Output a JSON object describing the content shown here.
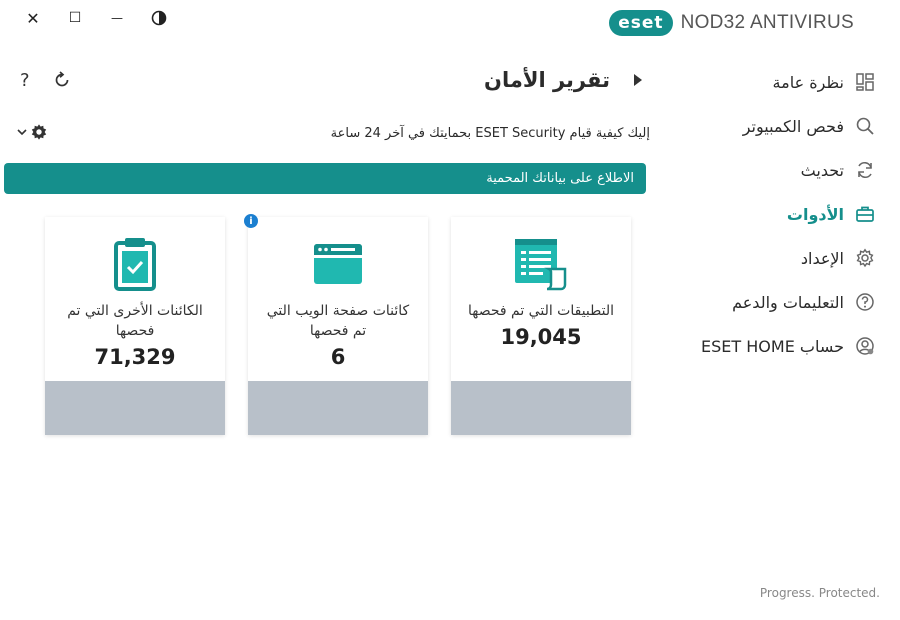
{
  "window": {
    "close_glyph": "✕",
    "maximize_glyph": "☐",
    "minimize_glyph": "—",
    "theme_icon": "contrast-icon"
  },
  "brand": {
    "logo_text": "eset",
    "product": "NOD32 ANTIVIRUS",
    "color": "#158f8c"
  },
  "sidebar": {
    "items": [
      {
        "label": "نظرة عامة",
        "icon": "dashboard-icon",
        "active": false
      },
      {
        "label": "فحص الكمبيوتر",
        "icon": "search-icon",
        "active": false
      },
      {
        "label": "تحديث",
        "icon": "refresh-icon",
        "active": false
      },
      {
        "label": "الأدوات",
        "icon": "toolbox-icon",
        "active": true
      },
      {
        "label": "الإعداد",
        "icon": "gear-icon",
        "active": false
      },
      {
        "label": "التعليمات والدعم",
        "icon": "help-icon",
        "active": false
      },
      {
        "label": "حساب ESET HOME",
        "icon": "user-icon",
        "active": false
      }
    ]
  },
  "header": {
    "title": "تقرير الأمان",
    "help_glyph": "?"
  },
  "subheader": {
    "text": "إليك كيفية قيام ESET Security بحمايتك في آخر 24 ساعة"
  },
  "banner": {
    "text": "الاطلاع على بياناتك المحمية"
  },
  "cards": [
    {
      "label": "الكائنات الأخرى التي تم فحصها",
      "value": "71,329",
      "icon": "clipboard-check-icon"
    },
    {
      "label": "كائنات صفحة الويب التي تم فحصها",
      "value": "6",
      "icon": "browser-window-icon",
      "info": "i"
    },
    {
      "label": "التطبيقات التي تم فحصها",
      "value": "19,045",
      "icon": "document-list-icon"
    }
  ],
  "footer": {
    "tagline": "Progress. Protected."
  },
  "colors": {
    "accent": "#158f8c",
    "card_bottom": "#b8c0c9",
    "info": "#1b7fd0"
  }
}
